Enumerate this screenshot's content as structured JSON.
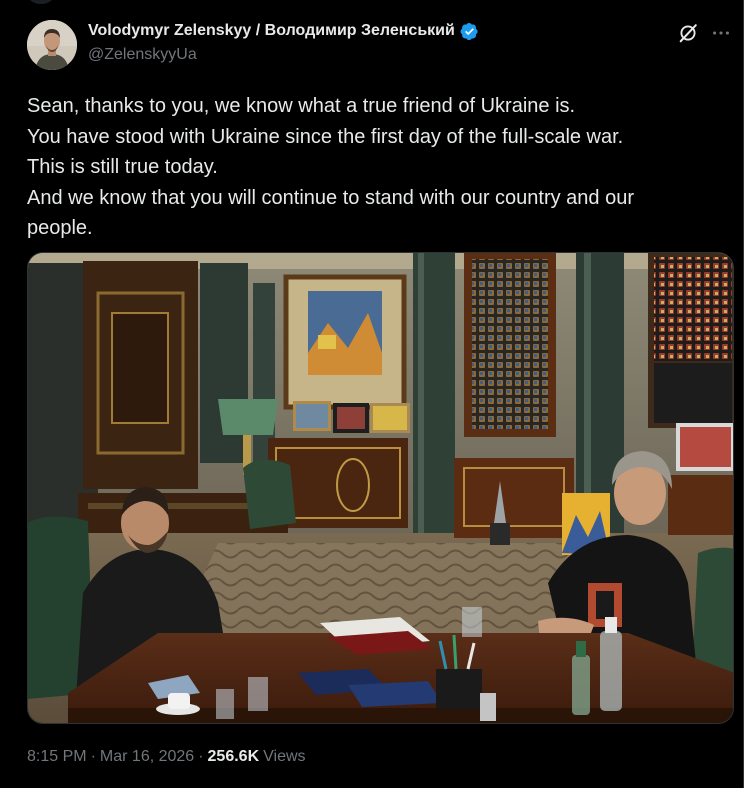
{
  "author": {
    "display_name": "Volodymyr Zelenskyy / Володимир Зеленський",
    "handle": "@ZelenskyyUa",
    "verified": true,
    "verified_color": "#1d9bf0"
  },
  "tweet": {
    "lines": [
      "Sean, thanks to you, we know what a true friend of Ukraine is.",
      "You have stood with Ukraine since the first day of the full-scale war.",
      "This is still true today.",
      "And we know that you will continue to stand with our country and our",
      "people."
    ]
  },
  "media": {
    "type": "photo"
  },
  "meta": {
    "time": "8:15 PM",
    "sep1": "·",
    "date": "Mar 16, 2026",
    "sep2": "·",
    "views_count": "256.6K",
    "views_label": "Views"
  },
  "icons": {
    "grok": "grok-icon",
    "more": "more-icon",
    "verified": "verified-badge-icon"
  },
  "colors": {
    "background": "#000000",
    "text_primary": "#e7e9ea",
    "text_secondary": "#71767b",
    "border": "#2f3336"
  }
}
